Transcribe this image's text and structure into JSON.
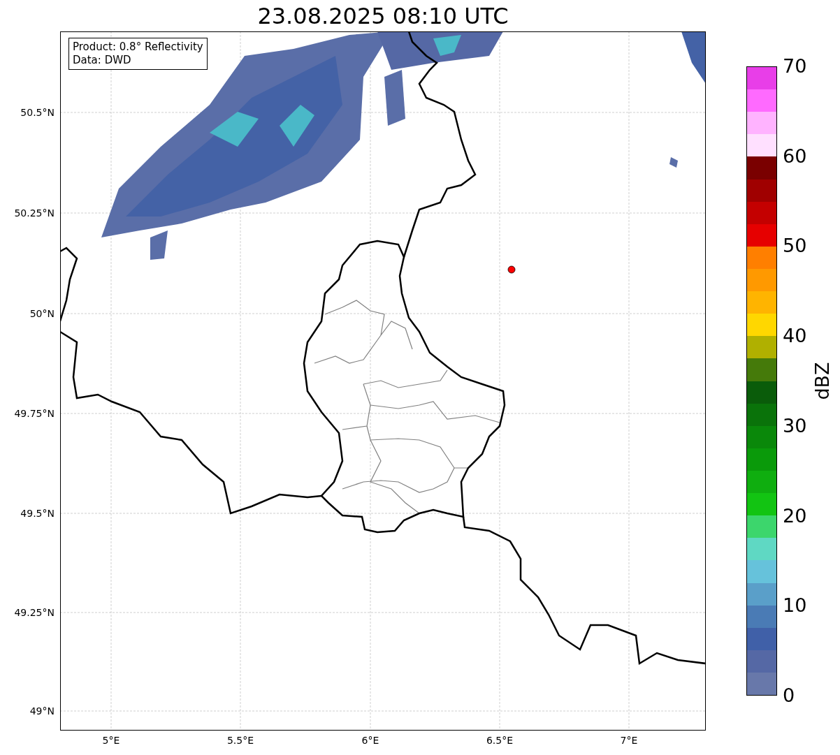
{
  "title": "23.08.2025 08:10 UTC",
  "info_box": [
    "Product: 0.8° Reflectivity",
    "Data: DWD"
  ],
  "latitude_labels": [
    "50.5°N",
    "50.25°N",
    "50°N",
    "49.75°N",
    "49.5°N",
    "49.25°N",
    "49°N"
  ],
  "longitude_labels": [
    "5°E",
    "5.5°E",
    "6°E",
    "6.5°E",
    "7°E"
  ],
  "colorbar": {
    "label": "dBZ",
    "ticks": [
      "70",
      "60",
      "50",
      "40",
      "30",
      "20",
      "10",
      "0"
    ],
    "bins": [
      {
        "color": "#e83ee8"
      },
      {
        "color": "#ff6aff"
      },
      {
        "color": "#ffb3ff"
      },
      {
        "color": "#ffe0ff"
      },
      {
        "color": "#7a0000"
      },
      {
        "color": "#a00000"
      },
      {
        "color": "#c40000"
      },
      {
        "color": "#e60000"
      },
      {
        "color": "#ff7f00"
      },
      {
        "color": "#ff9900"
      },
      {
        "color": "#ffb400"
      },
      {
        "color": "#ffd700"
      },
      {
        "color": "#b0b000"
      },
      {
        "color": "#457a0a"
      },
      {
        "color": "#0a5c0a"
      },
      {
        "color": "#0a730a"
      },
      {
        "color": "#0a880a"
      },
      {
        "color": "#0a9a0a"
      },
      {
        "color": "#0fae0f"
      },
      {
        "color": "#12c412"
      },
      {
        "color": "#3cd66c"
      },
      {
        "color": "#5fd8c3"
      },
      {
        "color": "#66c2db"
      },
      {
        "color": "#5a9fc9"
      },
      {
        "color": "#4a7bb5"
      },
      {
        "color": "#4060a8"
      },
      {
        "color": "#5568a5"
      },
      {
        "color": "#6878aa"
      }
    ]
  }
}
